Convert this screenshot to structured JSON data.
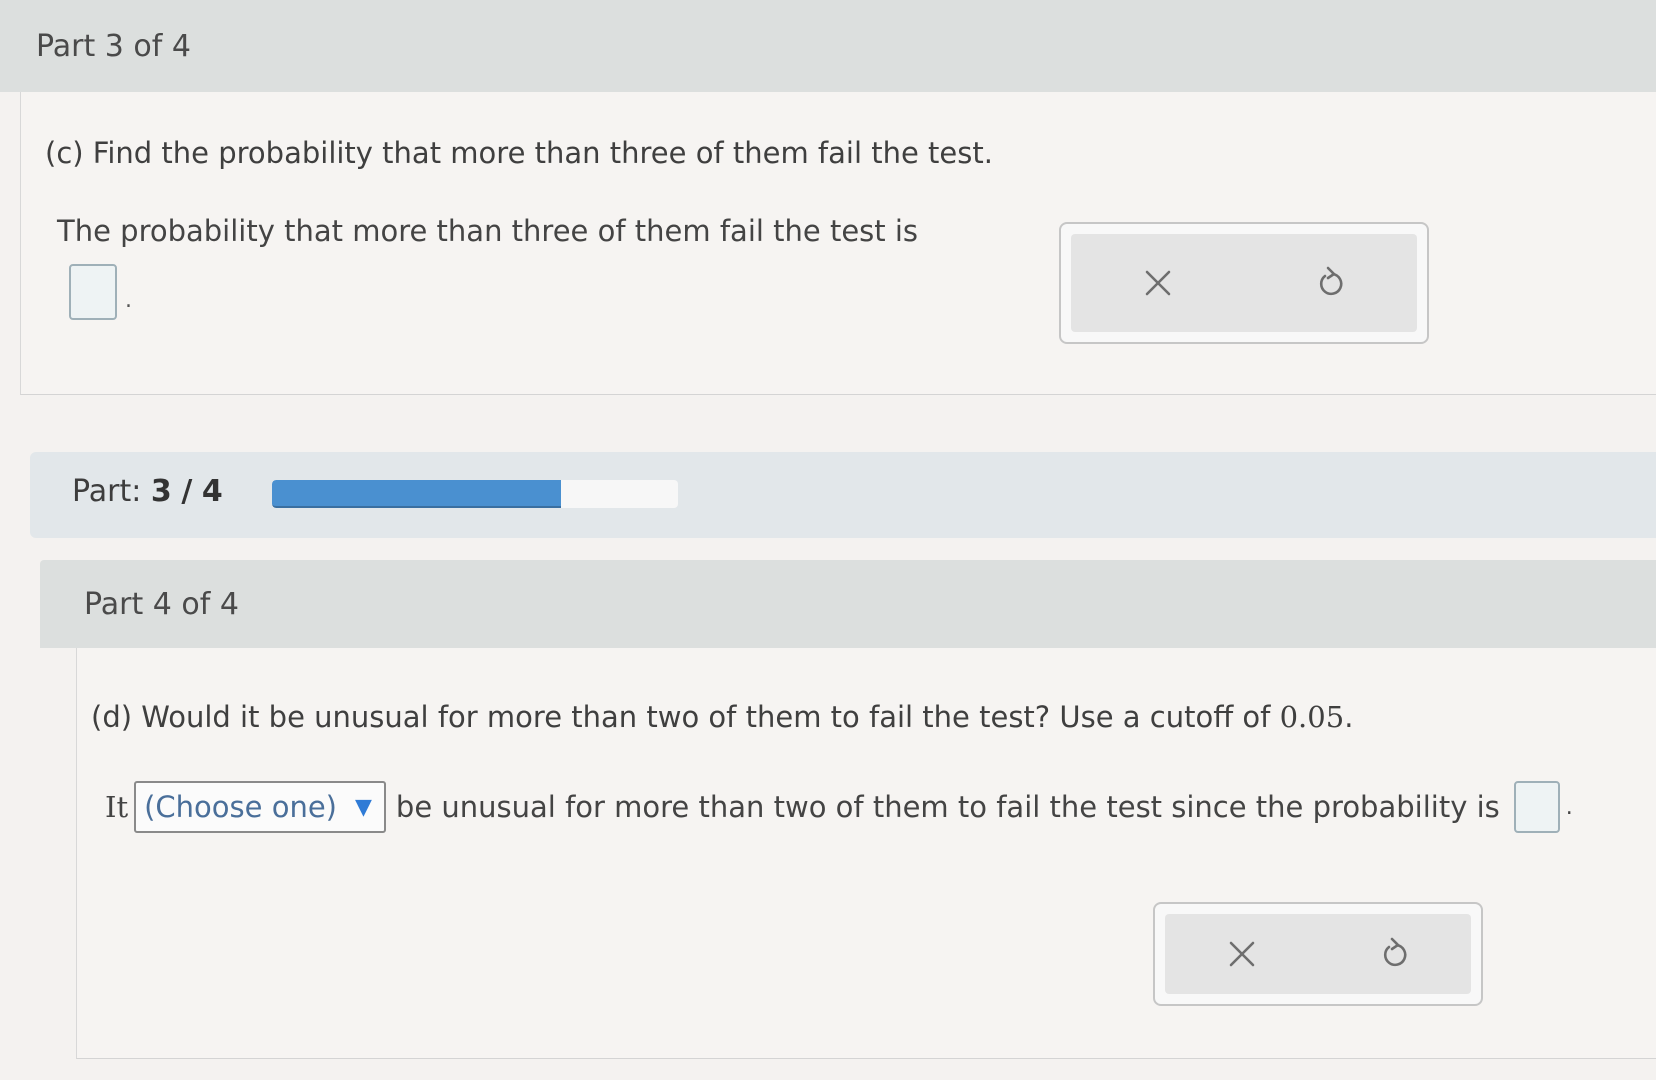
{
  "part3": {
    "header": "Part 3 of 4",
    "question": "(c) Find the probability that more than three of them fail the test.",
    "prompt": "The probability that more than three of them fail the test is",
    "answer_value": "",
    "answer_suffix": ".",
    "actions": {
      "clear_icon": "close-icon",
      "undo_icon": "undo-icon"
    }
  },
  "progress": {
    "label_prefix": "Part:",
    "current": "3",
    "separator": "/",
    "total": "4",
    "fraction_complete": 0.75,
    "fill_color": "#4a90d0"
  },
  "part4": {
    "header": "Part 4 of 4",
    "question_prefix": "(d) Would it be unusual for more than two of them to fail the test? Use a cutoff of ",
    "cutoff": "0.05",
    "question_suffix": ".",
    "sentence_start": "It",
    "dropdown": {
      "selected": "(Choose one)",
      "caret": "▼"
    },
    "sentence_middle": "be unusual for more than two of them to fail the test since the probability is",
    "answer_value": "",
    "answer_suffix": ".",
    "actions": {
      "clear_icon": "close-icon",
      "undo_icon": "undo-icon"
    }
  }
}
